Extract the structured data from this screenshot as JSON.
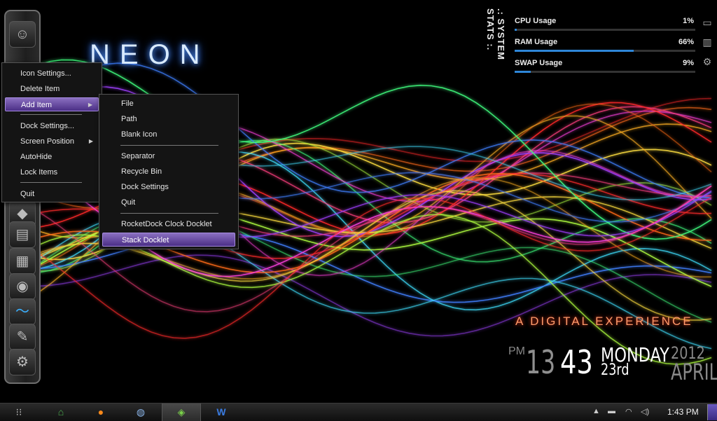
{
  "wallpaper": {
    "title": "NEON",
    "tagline": "A DIGITAL EXPERIENCE"
  },
  "clock": {
    "ampm": "PM",
    "hour": "13",
    "minute": "43",
    "day": "MONDAY",
    "date": "23rd",
    "year": "2012",
    "month": "APRIL"
  },
  "system_stats": {
    "title": ".: SYSTEM STATS :.",
    "items": [
      {
        "label": "CPU Usage",
        "value": "1%",
        "percent": 1,
        "icon": "monitor-icon"
      },
      {
        "label": "RAM Usage",
        "value": "66%",
        "percent": 66,
        "icon": "memory-icon"
      },
      {
        "label": "SWAP Usage",
        "value": "9%",
        "percent": 9,
        "icon": "gear-icon"
      }
    ],
    "bar_color": "#2e86d8"
  },
  "context_menu": {
    "items": [
      {
        "label": "Icon Settings..."
      },
      {
        "label": "Delete Item"
      },
      {
        "label": "Add Item",
        "submenu": true,
        "active": true
      },
      {
        "label": "Dock Settings..."
      },
      {
        "label": "Screen Position",
        "submenu": true
      },
      {
        "label": "AutoHide"
      },
      {
        "label": "Lock Items"
      },
      {
        "label": "Quit"
      }
    ]
  },
  "submenu": {
    "items": [
      {
        "label": "File"
      },
      {
        "label": "Path"
      },
      {
        "label": "Blank Icon"
      },
      {
        "label": "Separator"
      },
      {
        "label": "Recycle Bin"
      },
      {
        "label": "Dock Settings"
      },
      {
        "label": "Quit"
      },
      {
        "label": "RocketDock Clock Docklet"
      },
      {
        "label": "Stack Docklet",
        "active": true
      }
    ]
  },
  "taskbar": {
    "apps": [
      {
        "icon": "start-grid-icon"
      },
      {
        "icon": "home-folder-icon"
      },
      {
        "icon": "firefox-icon"
      },
      {
        "icon": "network-app-icon"
      },
      {
        "icon": "paint-app-icon",
        "active": true
      },
      {
        "icon": "word-icon"
      }
    ],
    "tray_time": "1:43 PM",
    "accent": "#5a4ab0"
  }
}
